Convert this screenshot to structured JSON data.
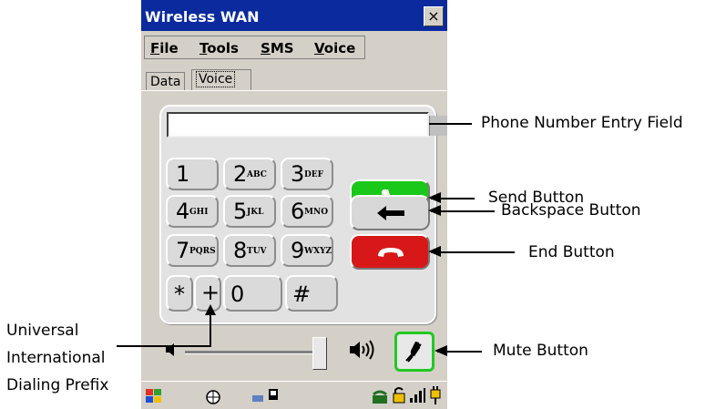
{
  "window": {
    "title": "Wireless WAN",
    "close_glyph": "×"
  },
  "menu": {
    "items": [
      {
        "label_first": "F",
        "label_rest": "ile"
      },
      {
        "label_first": "T",
        "label_rest": "ools"
      },
      {
        "label_first": "S",
        "label_rest": "MS"
      },
      {
        "label_first": "V",
        "label_rest": "oice"
      }
    ]
  },
  "tabs": {
    "data": "Data",
    "voice": "Voice"
  },
  "phone_field": {
    "value": ""
  },
  "keypad": {
    "keys": [
      {
        "digit": "1",
        "letters": ""
      },
      {
        "digit": "2",
        "letters": "ABC"
      },
      {
        "digit": "3",
        "letters": "DEF"
      },
      {
        "digit": "4",
        "letters": "GHI"
      },
      {
        "digit": "5",
        "letters": "JKL"
      },
      {
        "digit": "6",
        "letters": "MNO"
      },
      {
        "digit": "7",
        "letters": "PQRS"
      },
      {
        "digit": "8",
        "letters": "TUV"
      },
      {
        "digit": "9",
        "letters": "WXYZ"
      }
    ],
    "star": "*",
    "plus": "+",
    "zero": "0",
    "hash": "#"
  },
  "callouts": {
    "phone_field": "Phone Number Entry Field",
    "send": "Send Button",
    "backspace": "Backspace Button",
    "end": "End Button",
    "mute": "Mute Button",
    "prefix_line1": "Universal",
    "prefix_line2": "International",
    "prefix_line3": "Dialing Prefix"
  },
  "colors": {
    "send": "#19c819",
    "end": "#d81818",
    "titlebar": "#0a2a9e",
    "mute_border": "#22c822"
  }
}
